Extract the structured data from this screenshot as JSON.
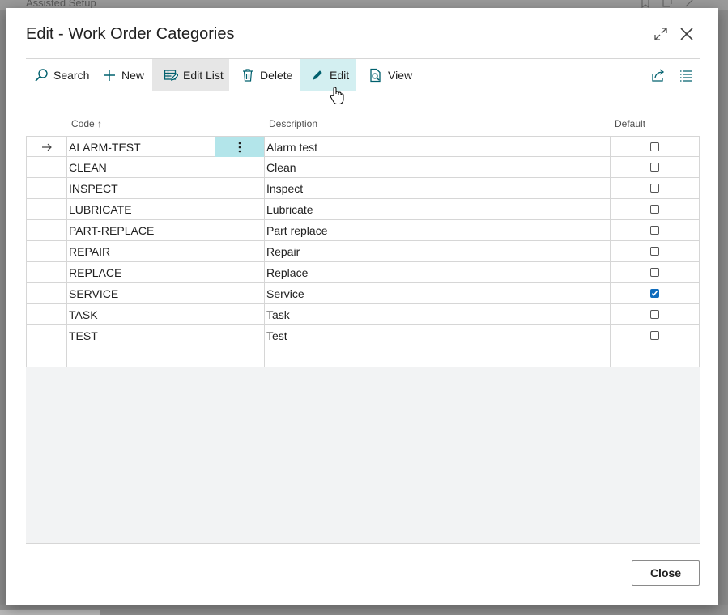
{
  "background": {
    "title": "Assisted Setup"
  },
  "dialog": {
    "title": "Edit - Work Order Categories",
    "close_label": "Close"
  },
  "actions": {
    "search": "Search",
    "new": "New",
    "edit_list": "Edit List",
    "delete": "Delete",
    "edit": "Edit",
    "view": "View"
  },
  "columns": {
    "code": "Code ↑",
    "description": "Description",
    "default": "Default"
  },
  "rows": [
    {
      "code": "ALARM-TEST",
      "description": "Alarm test",
      "default": false,
      "current": true
    },
    {
      "code": "CLEAN",
      "description": "Clean",
      "default": false
    },
    {
      "code": "INSPECT",
      "description": "Inspect",
      "default": false
    },
    {
      "code": "LUBRICATE",
      "description": "Lubricate",
      "default": false
    },
    {
      "code": "PART-REPLACE",
      "description": "Part replace",
      "default": false
    },
    {
      "code": "REPAIR",
      "description": "Repair",
      "default": false
    },
    {
      "code": "REPLACE",
      "description": "Replace",
      "default": false
    },
    {
      "code": "SERVICE",
      "description": "Service",
      "default": true
    },
    {
      "code": "TASK",
      "description": "Task",
      "default": false
    },
    {
      "code": "TEST",
      "description": "Test",
      "default": false
    }
  ],
  "icons": {
    "search": "search-icon",
    "new": "plus-icon",
    "edit_list": "edit-list-icon",
    "delete": "trash-icon",
    "edit": "pencil-icon",
    "view": "view-icon",
    "share": "share-icon",
    "list": "list-icon",
    "expand": "expand-icon",
    "close": "close-icon"
  },
  "colors": {
    "accent": "#0f6cbd",
    "teal": "#00606e",
    "selected_cell": "#b3e5ea",
    "edit_highlight": "#d3eff1"
  }
}
